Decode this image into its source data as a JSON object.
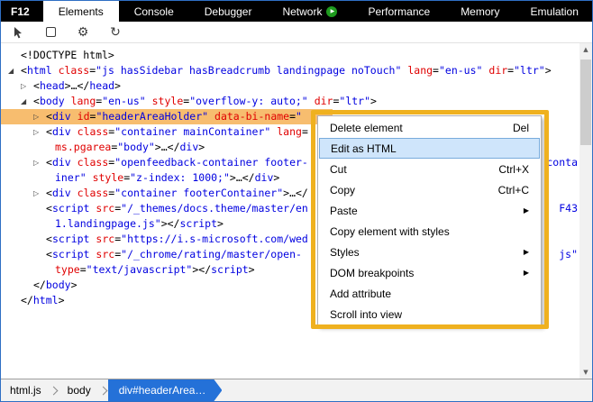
{
  "tabs": {
    "logo": "F12",
    "items": [
      {
        "label": "Elements",
        "active": true
      },
      {
        "label": "Console"
      },
      {
        "label": "Debugger"
      },
      {
        "label": "Network",
        "icon": "play-icon"
      },
      {
        "label": "Performance"
      },
      {
        "label": "Memory"
      },
      {
        "label": "Emulation"
      }
    ]
  },
  "toolbar": {
    "icons": [
      "select-element-icon",
      "highlight-region-icon",
      "settings-gear-icon",
      "dom-refresh-icon"
    ]
  },
  "dom_tree": {
    "lines": [
      {
        "ind": 0,
        "segs": [
          {
            "c": "p",
            "t": "<!DOCTYPE html>"
          }
        ]
      },
      {
        "ind": 0,
        "arrow": "exp",
        "segs": [
          {
            "c": "p",
            "t": "<"
          },
          {
            "c": "t",
            "t": "html"
          },
          {
            "c": "p",
            "t": " "
          },
          {
            "c": "a",
            "t": "class"
          },
          {
            "c": "p",
            "t": "="
          },
          {
            "c": "v",
            "t": "\"js hasSidebar hasBreadcrumb landingpage noTouch\""
          },
          {
            "c": "p",
            "t": " "
          },
          {
            "c": "a",
            "t": "lang"
          },
          {
            "c": "p",
            "t": "="
          },
          {
            "c": "v",
            "t": "\"en-us\""
          },
          {
            "c": "p",
            "t": " "
          },
          {
            "c": "a",
            "t": "dir"
          },
          {
            "c": "p",
            "t": "="
          },
          {
            "c": "v",
            "t": "\"ltr\""
          },
          {
            "c": "p",
            "t": ">"
          }
        ]
      },
      {
        "ind": 1,
        "arrow": "col",
        "segs": [
          {
            "c": "p",
            "t": "<"
          },
          {
            "c": "t",
            "t": "head"
          },
          {
            "c": "p",
            "t": ">…</"
          },
          {
            "c": "t",
            "t": "head"
          },
          {
            "c": "p",
            "t": ">"
          }
        ]
      },
      {
        "ind": 1,
        "arrow": "exp",
        "segs": [
          {
            "c": "p",
            "t": "<"
          },
          {
            "c": "t",
            "t": "body"
          },
          {
            "c": "p",
            "t": " "
          },
          {
            "c": "a",
            "t": "lang"
          },
          {
            "c": "p",
            "t": "="
          },
          {
            "c": "v",
            "t": "\"en-us\""
          },
          {
            "c": "p",
            "t": " "
          },
          {
            "c": "a",
            "t": "style"
          },
          {
            "c": "p",
            "t": "="
          },
          {
            "c": "v",
            "t": "\"overflow-y: auto;\""
          },
          {
            "c": "p",
            "t": " "
          },
          {
            "c": "a",
            "t": "dir"
          },
          {
            "c": "p",
            "t": "="
          },
          {
            "c": "v",
            "t": "\"ltr\""
          },
          {
            "c": "p",
            "t": ">"
          }
        ]
      },
      {
        "ind": 2,
        "arrow": "col",
        "sel": true,
        "segs": [
          {
            "c": "p",
            "t": "<"
          },
          {
            "c": "t",
            "t": "div"
          },
          {
            "c": "p",
            "t": " "
          },
          {
            "c": "a",
            "t": "id"
          },
          {
            "c": "p",
            "t": "="
          },
          {
            "c": "v",
            "t": "\"headerAreaHolder\""
          },
          {
            "c": "p",
            "t": " "
          },
          {
            "c": "a",
            "t": "data-bi-name"
          },
          {
            "c": "p",
            "t": "="
          },
          {
            "c": "v",
            "t": "\""
          }
        ]
      },
      {
        "ind": 2,
        "arrow": "col",
        "segs": [
          {
            "c": "p",
            "t": "<"
          },
          {
            "c": "t",
            "t": "div"
          },
          {
            "c": "p",
            "t": " "
          },
          {
            "c": "a",
            "t": "class"
          },
          {
            "c": "p",
            "t": "="
          },
          {
            "c": "v",
            "t": "\"container mainContainer\""
          },
          {
            "c": "p",
            "t": " "
          },
          {
            "c": "a",
            "t": "lang"
          },
          {
            "c": "p",
            "t": "="
          }
        ]
      },
      {
        "ind": 2,
        "wrap": true,
        "segs": [
          {
            "c": "a",
            "t": "ms.pgarea"
          },
          {
            "c": "p",
            "t": "="
          },
          {
            "c": "v",
            "t": "\"body\""
          },
          {
            "c": "p",
            "t": ">…</"
          },
          {
            "c": "t",
            "t": "div"
          },
          {
            "c": "p",
            "t": ">"
          }
        ]
      },
      {
        "ind": 2,
        "arrow": "col",
        "segs": [
          {
            "c": "p",
            "t": "<"
          },
          {
            "c": "t",
            "t": "div"
          },
          {
            "c": "p",
            "t": " "
          },
          {
            "c": "a",
            "t": "class"
          },
          {
            "c": "p",
            "t": "="
          },
          {
            "c": "v",
            "t": "\"openfeedback-container footer-"
          }
        ],
        "right": [
          {
            "c": "v",
            "t": "conta"
          }
        ]
      },
      {
        "ind": 2,
        "wrap": true,
        "segs": [
          {
            "c": "v",
            "t": "iner\""
          },
          {
            "c": "p",
            "t": " "
          },
          {
            "c": "a",
            "t": "style"
          },
          {
            "c": "p",
            "t": "="
          },
          {
            "c": "v",
            "t": "\"z-index: 1000;\""
          },
          {
            "c": "p",
            "t": ">…</"
          },
          {
            "c": "t",
            "t": "div"
          },
          {
            "c": "p",
            "t": ">"
          }
        ]
      },
      {
        "ind": 2,
        "arrow": "col",
        "segs": [
          {
            "c": "p",
            "t": "<"
          },
          {
            "c": "t",
            "t": "div"
          },
          {
            "c": "p",
            "t": " "
          },
          {
            "c": "a",
            "t": "class"
          },
          {
            "c": "p",
            "t": "="
          },
          {
            "c": "v",
            "t": "\"container footerContainer\""
          },
          {
            "c": "p",
            "t": ">…</"
          }
        ]
      },
      {
        "ind": 2,
        "segs": [
          {
            "c": "p",
            "t": "<"
          },
          {
            "c": "t",
            "t": "script"
          },
          {
            "c": "p",
            "t": " "
          },
          {
            "c": "a",
            "t": "src"
          },
          {
            "c": "p",
            "t": "="
          },
          {
            "c": "v",
            "t": "\"/_themes/docs.theme/master/en"
          }
        ],
        "right": [
          {
            "c": "v",
            "t": "F43"
          }
        ]
      },
      {
        "ind": 2,
        "wrap": true,
        "segs": [
          {
            "c": "v",
            "t": "1.landingpage.js\""
          },
          {
            "c": "p",
            "t": "></"
          },
          {
            "c": "t",
            "t": "script"
          },
          {
            "c": "p",
            "t": ">"
          }
        ]
      },
      {
        "ind": 2,
        "segs": [
          {
            "c": "p",
            "t": "<"
          },
          {
            "c": "t",
            "t": "script"
          },
          {
            "c": "p",
            "t": " "
          },
          {
            "c": "a",
            "t": "src"
          },
          {
            "c": "p",
            "t": "="
          },
          {
            "c": "v",
            "t": "\"https://i.s-microsoft.com/wed"
          }
        ]
      },
      {
        "ind": 2,
        "segs": [
          {
            "c": "p",
            "t": "<"
          },
          {
            "c": "t",
            "t": "script"
          },
          {
            "c": "p",
            "t": " "
          },
          {
            "c": "a",
            "t": "src"
          },
          {
            "c": "p",
            "t": "="
          },
          {
            "c": "v",
            "t": "\"/_chrome/rating/master/open-"
          }
        ],
        "right": [
          {
            "c": "v",
            "t": "js\""
          }
        ]
      },
      {
        "ind": 2,
        "wrap": true,
        "segs": [
          {
            "c": "a",
            "t": "type"
          },
          {
            "c": "p",
            "t": "="
          },
          {
            "c": "v",
            "t": "\"text/javascript\""
          },
          {
            "c": "p",
            "t": "></"
          },
          {
            "c": "t",
            "t": "script"
          },
          {
            "c": "p",
            "t": ">"
          }
        ]
      },
      {
        "ind": 1,
        "segs": [
          {
            "c": "p",
            "t": "</"
          },
          {
            "c": "t",
            "t": "body"
          },
          {
            "c": "p",
            "t": ">"
          }
        ]
      },
      {
        "ind": 0,
        "segs": [
          {
            "c": "p",
            "t": "</"
          },
          {
            "c": "t",
            "t": "html"
          },
          {
            "c": "p",
            "t": ">"
          }
        ]
      }
    ]
  },
  "context_menu": {
    "items": [
      {
        "label": "Delete element",
        "shortcut": "Del"
      },
      {
        "label": "Edit as HTML",
        "selected": true
      },
      {
        "label": "Cut",
        "shortcut": "Ctrl+X"
      },
      {
        "label": "Copy",
        "shortcut": "Ctrl+C"
      },
      {
        "label": "Paste",
        "submenu": true
      },
      {
        "label": "Copy element with styles"
      },
      {
        "label": "Styles",
        "submenu": true
      },
      {
        "label": "DOM breakpoints",
        "submenu": true
      },
      {
        "label": "Add attribute"
      },
      {
        "label": "Scroll into view"
      }
    ]
  },
  "breadcrumb": {
    "items": [
      {
        "label": "html.js"
      },
      {
        "label": "body"
      },
      {
        "label": "div#headerArea…",
        "active": true
      }
    ]
  },
  "colors": {
    "tab_bar": "#000000",
    "network_play_green": "#1f9b1f",
    "selection_orange": "#f7bd6f",
    "annotation_yellow": "#efb11f",
    "menu_highlight": "#cfe5fb",
    "menu_highlight_border": "#78abdc",
    "breadcrumb_active_blue": "#2471d8",
    "tag_blue": "#0000e0",
    "attr_red": "#e00000"
  }
}
